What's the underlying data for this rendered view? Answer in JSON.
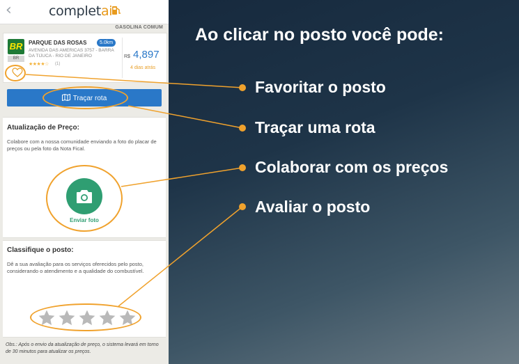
{
  "app": {
    "logo_main": "complet",
    "logo_accent": "ai",
    "fuel_type": "GASOLINA COMUM"
  },
  "station": {
    "name": "PARQUE DAS ROSAS",
    "distance": "5.0km",
    "address": "AVENIDA DAS AMERICAS 3757 - BARRA DA TIJUCA - RIO DE JANEIRO",
    "brand_logo": "BR",
    "brand_tag": "BR",
    "rating_stars": "★★★★☆",
    "rating_count": "(1)",
    "currency": "R$",
    "price": "4,897",
    "price_age": "4 dias atrás"
  },
  "route_button": {
    "label": "Traçar rota",
    "icon": "map-icon"
  },
  "price_update": {
    "title": "Atualização de Preço:",
    "text": "Colabore com a nossa comunidade enviando a foto do placar de preços ou pela foto da Nota Fical.",
    "camera_label": "Enviar foto",
    "icon": "camera-icon"
  },
  "rating": {
    "title": "Classifique o posto:",
    "text": "Dê a sua avaliação para os serviços oferecidos pelo posto, considerando o atendimento e a qualidade do combustível.",
    "stars": 5
  },
  "obs": "Obs.: Após o envio da atualização de preço, o sistema levará em torno de 30 minutos para atualizar os preços.",
  "callouts": {
    "headline": "Ao clicar no posto você pode:",
    "items": [
      "Favoritar o posto",
      "Traçar uma rota",
      "Colaborar com os preços",
      "Avaliar o posto"
    ]
  },
  "colors": {
    "accent": "#f0a22d",
    "primary_blue": "#2a78c8",
    "green": "#2f9e72",
    "brand_green": "#1f7a36"
  }
}
